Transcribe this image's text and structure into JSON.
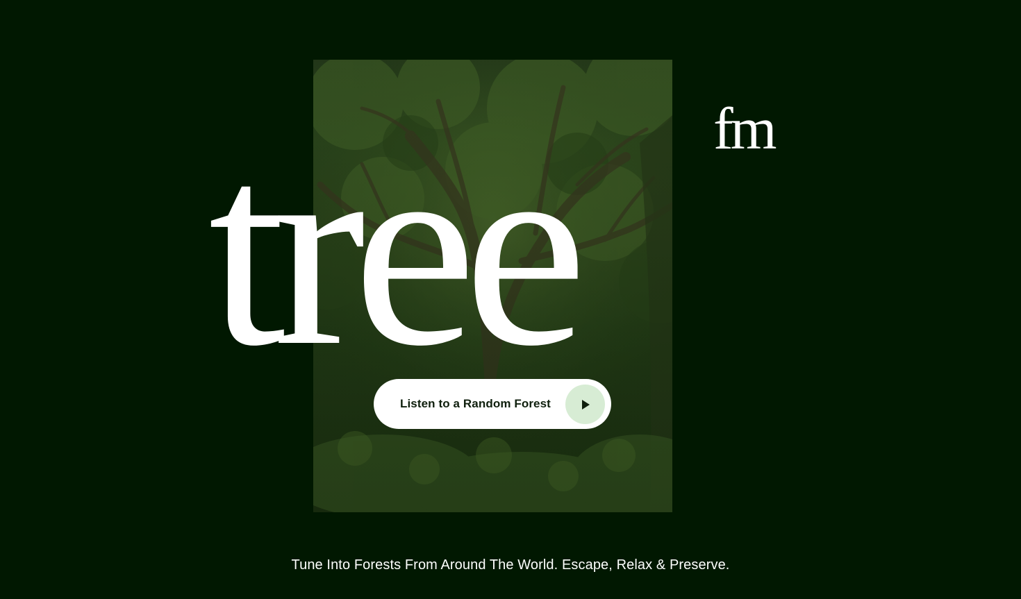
{
  "brand": {
    "wordmark": "tree",
    "superscript": "fm"
  },
  "hero": {
    "image_alt": "forest-canopy-photo",
    "cta_label": "Listen to a Random Forest",
    "cta_icon": "play-icon"
  },
  "footer": {
    "tagline": "Tune Into Forests From Around The World. Escape, Relax & Preserve."
  },
  "colors": {
    "background": "#011801",
    "button_bg": "#ffffff",
    "play_circle": "#d7ecd4",
    "text": "#ffffff"
  }
}
